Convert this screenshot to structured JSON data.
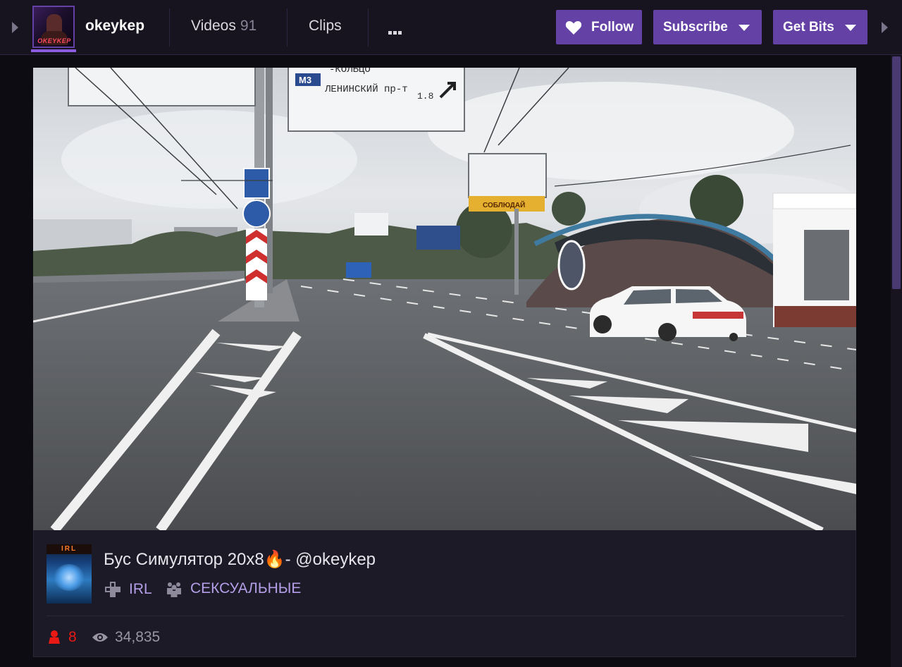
{
  "channel": {
    "name": "okeykep",
    "avatar_logo_text": "OKEYKEP"
  },
  "nav": {
    "videos_label": "Videos",
    "videos_count": "91",
    "clips_label": "Clips"
  },
  "buttons": {
    "follow": "Follow",
    "subscribe": "Subscribe",
    "get_bits": "Get Bits"
  },
  "video": {
    "sign_top_line": "-КОЛЬЦО",
    "sign_route_badge": "М3",
    "sign_route_text": "ЛЕНИНСКИЙ пр-т",
    "sign_distance": "1.8",
    "billboard_text": "СОБЛЮДАЙ"
  },
  "stream": {
    "title": "Бус Симулятор 20х8🔥- @okeykep",
    "thumb_label": "IRL",
    "tags": [
      {
        "label": "IRL"
      },
      {
        "label": "СЕКСУАЛЬНЫЕ"
      }
    ],
    "viewers": "8",
    "views": "34,835"
  },
  "colors": {
    "accent": "#6441a4",
    "link": "#b49ee8",
    "live_red": "#e91916",
    "background": "#0e0c13"
  },
  "icons": [
    "chevron-left-icon",
    "chevron-right-icon",
    "heart-icon",
    "caret-down-icon",
    "more-dots-icon",
    "gamepad-icon",
    "people-icon",
    "viewer-icon",
    "eye-icon"
  ]
}
